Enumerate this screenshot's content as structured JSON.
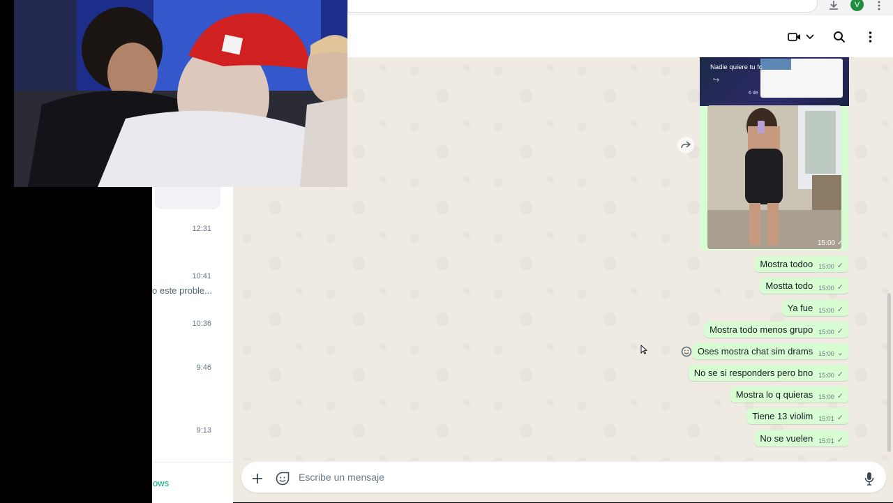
{
  "header": {
    "icons": [
      "video-call-icon",
      "chevron-down-icon",
      "search-icon",
      "more-options-icon"
    ]
  },
  "browser": {
    "profile_initial": "V",
    "icons": [
      "download-icon",
      "more-vertical-icon"
    ]
  },
  "chat_list": {
    "items": [
      {
        "time": "12:31",
        "preview": ""
      },
      {
        "time": "10:41",
        "preview": "o este proble..."
      },
      {
        "time": "10:36",
        "preview": ""
      },
      {
        "time": "9:46",
        "preview": ""
      },
      {
        "time": "9:13",
        "preview": ""
      }
    ],
    "footer_link": "ows"
  },
  "media_message": {
    "forwarded_text": "Nadie quiere tu fc",
    "forwarded_date": "6 de",
    "time": "15:00",
    "status": "✓"
  },
  "messages": [
    {
      "text": "Mostra todoo",
      "time": "15:00",
      "status": "✓"
    },
    {
      "text": "Mostta todo",
      "time": "15:00",
      "status": "✓"
    },
    {
      "text": "Ya fue",
      "time": "15:00",
      "status": "✓"
    },
    {
      "text": "Mostra todo menos grupo",
      "time": "15:00",
      "status": "✓"
    },
    {
      "text": "Oses mostra chat sim drams",
      "time": "15:00",
      "status": "⌄"
    },
    {
      "text": "No se si responders pero bno",
      "time": "15:00",
      "status": "✓"
    },
    {
      "text": "Mostra lo q quieras",
      "time": "15:00",
      "status": "✓"
    },
    {
      "text": "Tiene 13 violim",
      "time": "15:01",
      "status": "✓"
    },
    {
      "text": "No se vuelen",
      "time": "15:01",
      "status": "✓"
    }
  ],
  "composer": {
    "placeholder": "Escribe un mensaje"
  },
  "colors": {
    "outgoing_bubble": "#d9fdd3",
    "chat_background": "#efeae2",
    "accent": "#00a884"
  }
}
